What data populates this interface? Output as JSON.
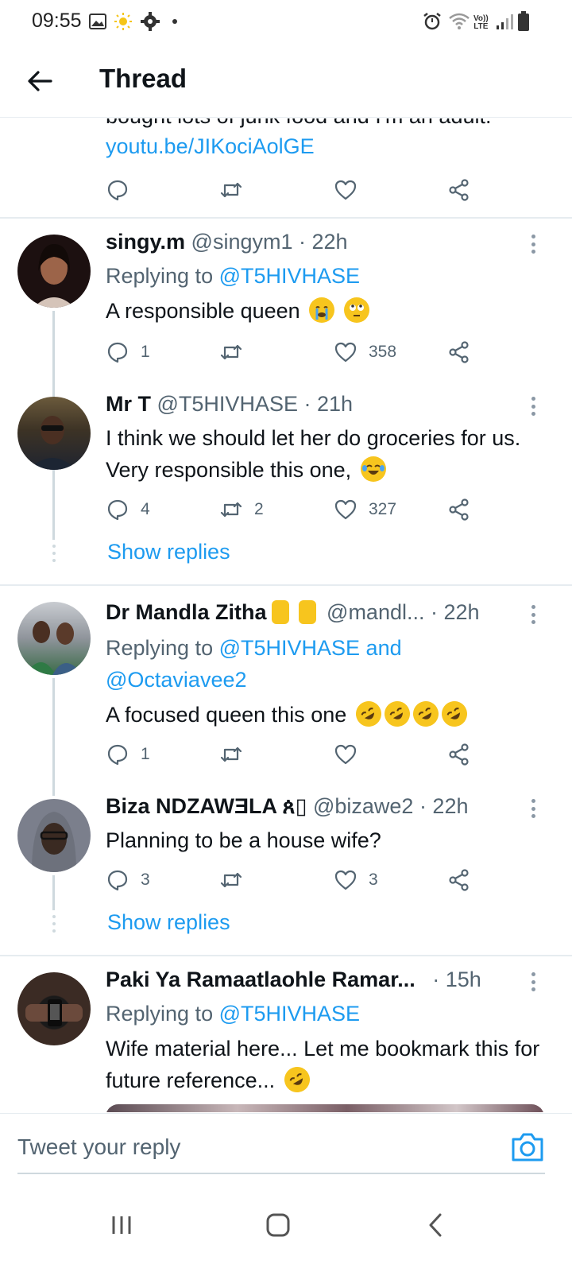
{
  "status_bar": {
    "time": "09:55",
    "left_icons": [
      "gallery-icon",
      "sun-icon",
      "gear-icon",
      "dot-icon"
    ],
    "right_icons": [
      "alarm-icon",
      "wifi-icon",
      "volte-icon",
      "signal-icon",
      "battery-icon"
    ],
    "volte_label": "Vo))\nLTE"
  },
  "header": {
    "title": "Thread",
    "back_icon": "arrow-left-icon"
  },
  "partial_tweet": {
    "text": "bought lots of junk food and I'm an adult.",
    "link": "youtu.be/JIKociAolGE"
  },
  "tweets": [
    {
      "name": "singy.m",
      "handle": "@singym1 · 22h",
      "replying_prefix": "Replying to",
      "replying_to": "@T5HIVHASE",
      "text": "A responsible queen",
      "emojis": [
        "loudly-crying-face",
        "face-with-rolling-eyes"
      ],
      "replies": "1",
      "retweets": "",
      "likes": "358"
    },
    {
      "name": "Mr T",
      "handle": "@T5HIVHASE · 21h",
      "text": "I think we should let her do groceries for us. Very responsible this one,",
      "emojis": [
        "face-with-tears-of-joy"
      ],
      "replies": "4",
      "retweets": "2",
      "likes": "327",
      "show_replies": "Show replies"
    },
    {
      "name": "Dr Mandla Zitha",
      "name_emojis": [
        "victory-hand",
        "victory-hand"
      ],
      "handle": "@mandl... · 22h",
      "replying_prefix": "Replying to",
      "replying_to": "@T5HIVHASE and",
      "replying_to_2": "@Octaviavee2",
      "text": "A focused queen this one",
      "emojis": [
        "rolling-on-floor-laughing",
        "rolling-on-floor-laughing",
        "rolling-on-floor-laughing",
        "rolling-on-floor-laughing"
      ],
      "replies": "1",
      "retweets": "",
      "likes": ""
    },
    {
      "name": "Biza NDZAWƎLA ጰ▯",
      "handle": "@bizawe2 · 22h",
      "text": "Planning to be a house wife?",
      "replies": "3",
      "retweets": "",
      "likes": "3",
      "show_replies": "Show replies"
    },
    {
      "name": "Paki Ya Ramaatlaohle Ramar...",
      "handle": "· 15h",
      "replying_prefix": "Replying to",
      "replying_to": "@T5HIVHASE",
      "text": "Wife material here... Let me bookmark this for future reference...",
      "emojis": [
        "rolling-on-floor-laughing"
      ]
    }
  ],
  "reply_bar": {
    "placeholder": "Tweet your reply",
    "camera_icon": "camera-icon"
  },
  "nav_bar": {
    "buttons": [
      "recents-icon",
      "home-icon",
      "back-icon"
    ]
  },
  "colors": {
    "accent": "#1d9bf0",
    "text": "#0f1419",
    "secondary": "#536471",
    "divider": "#e6ecf0"
  }
}
